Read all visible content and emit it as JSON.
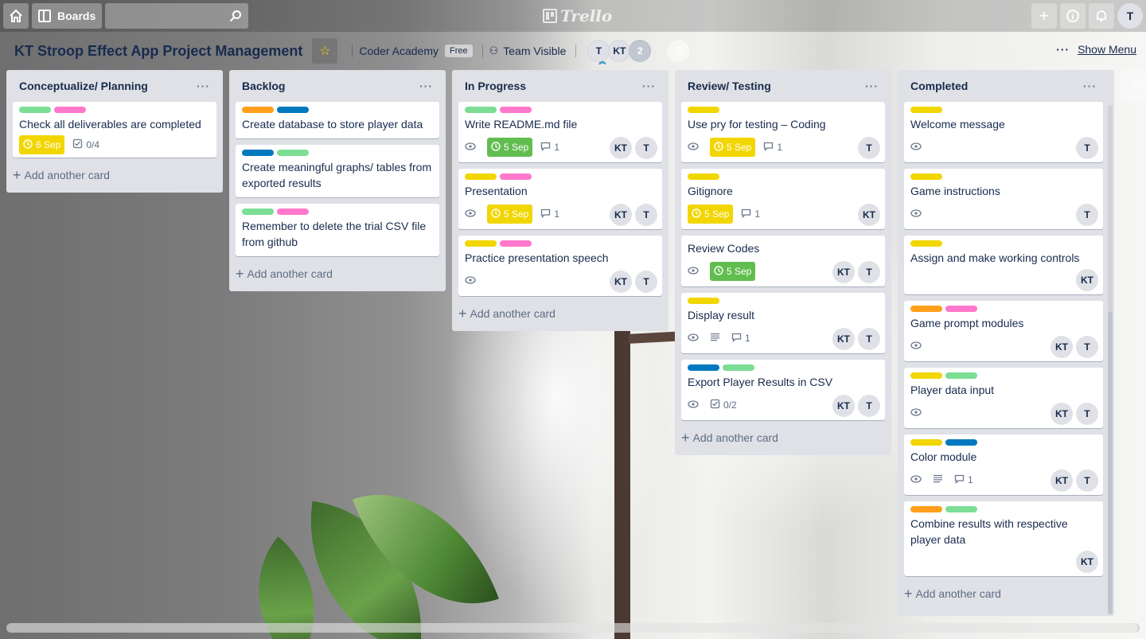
{
  "topbar": {
    "boards_label": "Boards",
    "search_placeholder": "",
    "logo_text": "Trello",
    "user_initial": "T"
  },
  "board": {
    "title": "KT Stroop Effect App Project Management",
    "team": "Coder Academy",
    "plan": "Free",
    "visibility": "Team Visible",
    "members": [
      "T",
      "KT"
    ],
    "member_count": "2",
    "show_menu": "Show Menu"
  },
  "add_card_label": "Add another card",
  "lists": [
    {
      "title": "Conceptualize/ Planning",
      "cards": [
        {
          "title": "Check all deliverables are completed",
          "labels": [
            "green",
            "pink"
          ],
          "due": "6 Sep",
          "due_color": "yellow",
          "checklist": "0/4",
          "members": []
        }
      ]
    },
    {
      "title": "Backlog",
      "cards": [
        {
          "title": "Create database to store player data",
          "labels": [
            "orange",
            "blue"
          ],
          "members": []
        },
        {
          "title": "Create meaningful graphs/ tables from exported results",
          "labels": [
            "blue",
            "green"
          ],
          "members": []
        },
        {
          "title": "Remember to delete the trial CSV file from github",
          "labels": [
            "green",
            "pink"
          ],
          "members": []
        }
      ]
    },
    {
      "title": "In Progress",
      "cards": [
        {
          "title": "Write README.md file",
          "labels": [
            "green",
            "pink"
          ],
          "watch": true,
          "due": "5 Sep",
          "due_color": "green",
          "comments": "1",
          "members": [
            "KT",
            "T"
          ]
        },
        {
          "title": "Presentation",
          "labels": [
            "yellow",
            "pink"
          ],
          "watch": true,
          "due": "5 Sep",
          "due_color": "yellow",
          "comments": "1",
          "members": [
            "KT",
            "T"
          ]
        },
        {
          "title": "Practice presentation speech",
          "labels": [
            "yellow",
            "pink"
          ],
          "watch": true,
          "members": [
            "KT",
            "T"
          ]
        }
      ]
    },
    {
      "title": "Review/ Testing",
      "cards": [
        {
          "title": "Use pry for testing – Coding",
          "labels": [
            "yellow"
          ],
          "watch": true,
          "due": "5 Sep",
          "due_color": "yellow",
          "comments": "1",
          "members": [
            "T"
          ]
        },
        {
          "title": "Gitignore",
          "labels": [
            "yellow"
          ],
          "due": "5 Sep",
          "due_color": "yellow",
          "comments": "1",
          "members": [
            "KT"
          ]
        },
        {
          "title": "Review Codes",
          "labels": [],
          "watch": true,
          "due": "5 Sep",
          "due_color": "green",
          "members": [
            "KT",
            "T"
          ]
        },
        {
          "title": "Display result",
          "labels": [
            "yellow"
          ],
          "watch": true,
          "description": true,
          "comments": "1",
          "members": [
            "KT",
            "T"
          ]
        },
        {
          "title": "Export Player Results in CSV",
          "labels": [
            "blue",
            "green"
          ],
          "watch": true,
          "checklist": "0/2",
          "members": [
            "KT",
            "T"
          ]
        }
      ]
    },
    {
      "title": "Completed",
      "cards": [
        {
          "title": "Welcome message",
          "labels": [
            "yellow"
          ],
          "watch": true,
          "members": [
            "T"
          ]
        },
        {
          "title": "Game instructions",
          "labels": [
            "yellow"
          ],
          "watch": true,
          "members": [
            "T"
          ]
        },
        {
          "title": "Assign and make working controls",
          "labels": [
            "yellow"
          ],
          "members": [
            "KT"
          ]
        },
        {
          "title": "Game prompt modules",
          "labels": [
            "orange",
            "pink"
          ],
          "watch": true,
          "members": [
            "KT",
            "T"
          ]
        },
        {
          "title": "Player data input",
          "labels": [
            "yellow",
            "green"
          ],
          "watch": true,
          "members": [
            "KT",
            "T"
          ]
        },
        {
          "title": "Color module",
          "labels": [
            "yellow",
            "blue"
          ],
          "watch": true,
          "description": true,
          "comments": "1",
          "members": [
            "KT",
            "T"
          ]
        },
        {
          "title": "Combine results with respective player data",
          "labels": [
            "orange",
            "green"
          ],
          "members": [
            "KT"
          ]
        }
      ]
    }
  ]
}
